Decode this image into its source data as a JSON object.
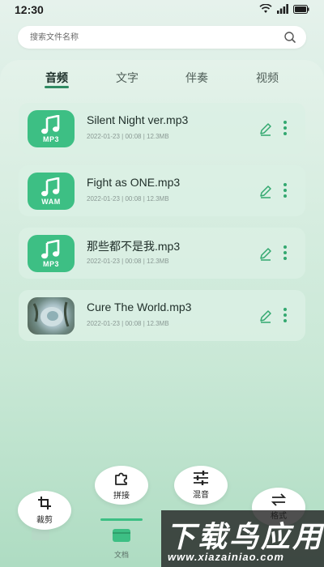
{
  "status_bar": {
    "time": "12:30"
  },
  "search": {
    "placeholder": "搜索文件名称"
  },
  "tabs": [
    {
      "label": "音频",
      "active": true
    },
    {
      "label": "文字",
      "active": false
    },
    {
      "label": "伴奏",
      "active": false
    },
    {
      "label": "视频",
      "active": false
    }
  ],
  "files": [
    {
      "name": "Silent Night ver.mp3",
      "meta": "2022-01-23 | 00:08 | 12.3MB",
      "format": "MP3",
      "thumb": "music-note-icon"
    },
    {
      "name": "Fight as ONE.mp3",
      "meta": "2022-01-23 | 00:08 | 12.3MB",
      "format": "WAM",
      "thumb": "music-note-icon"
    },
    {
      "name": "那些都不是我.mp3",
      "meta": "2022-01-23 | 00:08 | 12.3MB",
      "format": "MP3",
      "thumb": "music-note-icon"
    },
    {
      "name": "Cure The World.mp3",
      "meta": "2022-01-23 | 00:08 | 12.3MB",
      "format": "",
      "thumb": "album-cover-image"
    }
  ],
  "tools": {
    "crop": "裁剪",
    "splice": "拼接",
    "mix": "混音",
    "convert": "格式"
  },
  "bottom_nav": {
    "docs": "文档"
  },
  "watermark": {
    "main": "下载鸟应用",
    "sub": "www.xiazainiao.com"
  },
  "colors": {
    "accent": "#3dbf84",
    "tab_indicator": "#2f8a62",
    "background": "#d3ebdf"
  }
}
